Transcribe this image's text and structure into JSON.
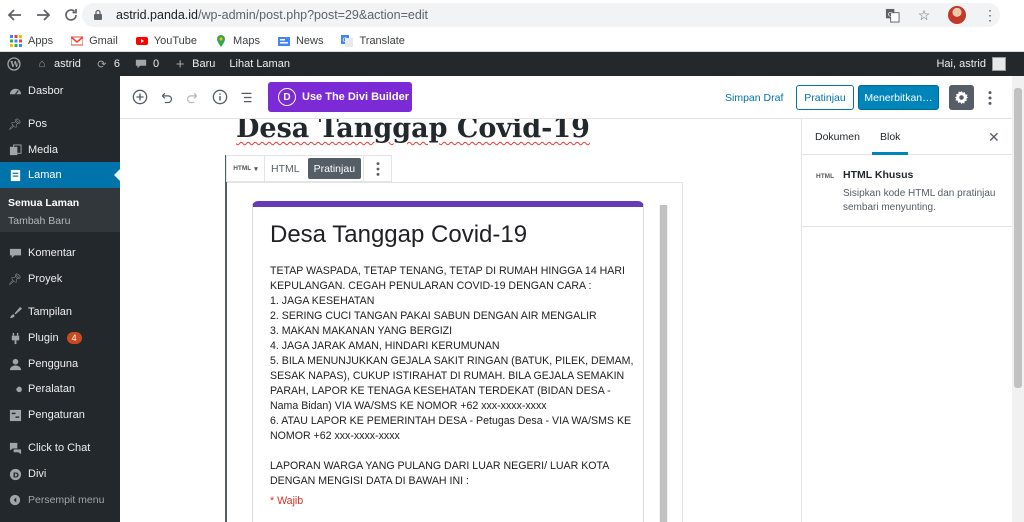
{
  "browser": {
    "url_host": "astrid.panda.id",
    "url_path": "/wp-admin/post.php?post=29&action=edit",
    "bookmarks": [
      {
        "label": "Apps",
        "icon": "apps-grid-icon",
        "color": "#4285f4"
      },
      {
        "label": "Gmail",
        "icon": "gmail-icon",
        "color": "#ea4335"
      },
      {
        "label": "YouTube",
        "icon": "youtube-icon",
        "color": "#ff0000"
      },
      {
        "label": "Maps",
        "icon": "maps-icon",
        "color": "#34a853"
      },
      {
        "label": "News",
        "icon": "news-icon",
        "color": "#4285f4"
      },
      {
        "label": "Translate",
        "icon": "translate-icon",
        "color": "#4285f4"
      }
    ]
  },
  "adminbar": {
    "site_name": "astrid",
    "updates_count": "6",
    "comments_count": "0",
    "new_label": "Baru",
    "view_label": "Lihat Laman",
    "greeting": "Hai, astrid"
  },
  "sidebar": {
    "items": [
      {
        "label": "Dasbor",
        "icon": "dashboard-icon"
      },
      {
        "label": "Pos",
        "icon": "pin-icon"
      },
      {
        "label": "Media",
        "icon": "media-icon"
      },
      {
        "label": "Laman",
        "icon": "page-icon"
      },
      {
        "label": "Komentar",
        "icon": "comment-icon"
      },
      {
        "label": "Proyek",
        "icon": "pin-icon"
      },
      {
        "label": "Tampilan",
        "icon": "brush-icon"
      },
      {
        "label": "Plugin",
        "icon": "plugin-icon",
        "badge": "4"
      },
      {
        "label": "Pengguna",
        "icon": "user-icon"
      },
      {
        "label": "Peralatan",
        "icon": "wrench-icon"
      },
      {
        "label": "Pengaturan",
        "icon": "settings-icon"
      },
      {
        "label": "Click to Chat",
        "icon": "chat-icon"
      },
      {
        "label": "Divi",
        "icon": "divi-icon"
      },
      {
        "label": "Persempit menu",
        "icon": "collapse-icon"
      }
    ],
    "submenu": [
      "Semua Laman",
      "Tambah Baru"
    ]
  },
  "toolbar": {
    "divi_label": "Use The Divi Builder",
    "save_draft": "Simpan Draf",
    "preview": "Pratinjau",
    "publish": "Menerbitkan…"
  },
  "editor": {
    "post_title": "Desa Tanggap Covid-19",
    "block_type_label": "HTML",
    "tab_html": "HTML",
    "tab_preview": "Pratinjau",
    "form_title": "Desa Tanggap Covid-19",
    "form_desc": "TETAP WASPADA, TETAP TENANG, TETAP DI RUMAH HINGGA 14 HARI KEPULANGAN. CEGAH PENULARAN COVID-19 DENGAN CARA :\n1. JAGA KESEHATAN\n2. SERING CUCI TANGAN PAKAI SABUN DENGAN AIR MENGALIR\n3. MAKAN MAKANAN YANG BERGIZI\n4. JAGA JARAK AMAN, HINDARI KERUMUNAN\n5. BILA MENUNJUKKAN GEJALA SAKIT RINGAN (BATUK, PILEK, DEMAM, SESAK NAPAS), CUKUP ISTIRAHAT DI RUMAH. BILA GEJALA SEMAKIN PARAH, LAPOR KE TENAGA KESEHATAN TERDEKAT (BIDAN DESA - Nama Bidan) VIA WA/SMS KE NOMOR +62 xxx-xxxx-xxxx\n6. ATAU LAPOR KE PEMERINTAH DESA - Petugas Desa - VIA WA/SMS KE NOMOR +62 xxx-xxxx-xxxx\n\nLAPORAN WARGA YANG PULANG DARI LUAR NEGERI/ LUAR KOTA DENGAN MENGISI DATA DI BAWAH INI :",
    "required_note": "* Wajib"
  },
  "panel": {
    "tab_document": "Dokumen",
    "tab_block": "Blok",
    "block_title": "HTML Khusus",
    "block_desc": "Sisipkan kode HTML dan pratinjau sembari menyunting.",
    "block_icon_label": "HTML"
  },
  "colors": {
    "wp_dark": "#23282d",
    "wp_blue": "#0073aa",
    "divi_purple": "#7b2ad5",
    "form_purple": "#673ab7",
    "required_red": "#d93025",
    "badge_orange": "#ca4a1f"
  }
}
